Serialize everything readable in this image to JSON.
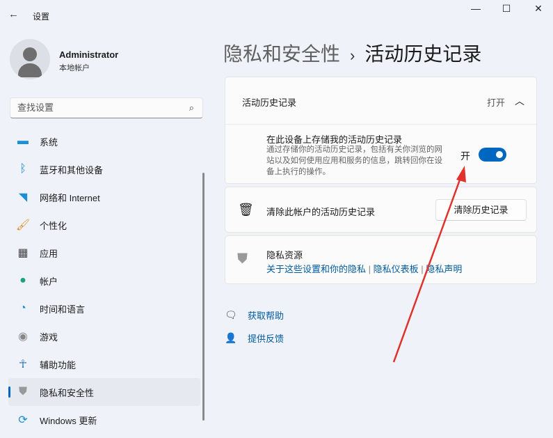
{
  "window": {
    "title": "设置",
    "back_icon": "←",
    "minimize": "—",
    "maximize": "☐",
    "close": "✕"
  },
  "user": {
    "name": "Administrator",
    "type": "本地帐户"
  },
  "search": {
    "placeholder": "查找设置",
    "icon": "⌕"
  },
  "nav": [
    {
      "label": "系统",
      "icon": "monitor",
      "color": "#1a8fd6"
    },
    {
      "label": "蓝牙和其他设备",
      "icon": "bluetooth",
      "color": "#1a8fd6"
    },
    {
      "label": "网络和 Internet",
      "icon": "wifi",
      "color": "#1a8fd6"
    },
    {
      "label": "个性化",
      "icon": "brush",
      "color": "#e38b2c"
    },
    {
      "label": "应用",
      "icon": "apps",
      "color": "#444"
    },
    {
      "label": "帐户",
      "icon": "person",
      "color": "#1ba37a"
    },
    {
      "label": "时间和语言",
      "icon": "globe-clock",
      "color": "#1a8fd6"
    },
    {
      "label": "游戏",
      "icon": "gamepad",
      "color": "#888"
    },
    {
      "label": "辅助功能",
      "icon": "accessibility",
      "color": "#1a6fb0"
    },
    {
      "label": "隐私和安全性",
      "icon": "shield",
      "color": "#999",
      "selected": true
    },
    {
      "label": "Windows 更新",
      "icon": "update",
      "color": "#1a8fd6"
    }
  ],
  "breadcrumb": {
    "parent": "隐私和安全性",
    "sep": "›",
    "current": "活动历史记录"
  },
  "activity": {
    "header": "活动历史记录",
    "status": "打开",
    "store_title": "在此设备上存储我的活动历史记录",
    "store_desc": "通过存储你的活动历史记录，包括有关你浏览的网站以及如何使用应用和服务的信息，跳转回你在设备上执行的操作。",
    "toggle_label": "开",
    "toggle_on": true
  },
  "clear": {
    "label": "清除此帐户的活动历史记录",
    "button": "清除历史记录"
  },
  "privacy": {
    "title": "隐私资源",
    "links": [
      "关于这些设置和你的隐私",
      "隐私仪表板",
      "隐私声明"
    ],
    "sep": "|"
  },
  "help": {
    "get_help": "获取帮助",
    "feedback": "提供反馈"
  },
  "colors": {
    "accent": "#0067c0",
    "annotation": "#e0312a"
  }
}
